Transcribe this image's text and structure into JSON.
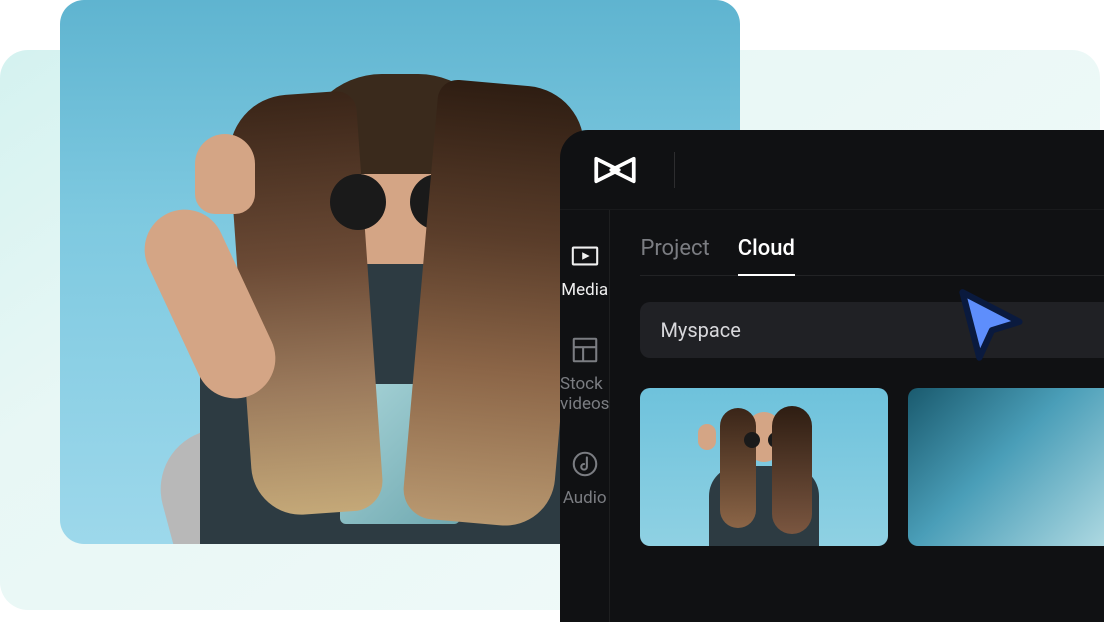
{
  "sidebar": {
    "items": [
      {
        "label": "Media"
      },
      {
        "label": "Stock videos"
      },
      {
        "label": "Audio"
      }
    ]
  },
  "tabs": {
    "project": "Project",
    "cloud": "Cloud",
    "active": "cloud"
  },
  "space": {
    "selected": "Myspace"
  },
  "colors": {
    "bg": "#101113",
    "accent": "#5e8efc",
    "text_muted": "#7b7d82",
    "text": "#ffffff"
  }
}
